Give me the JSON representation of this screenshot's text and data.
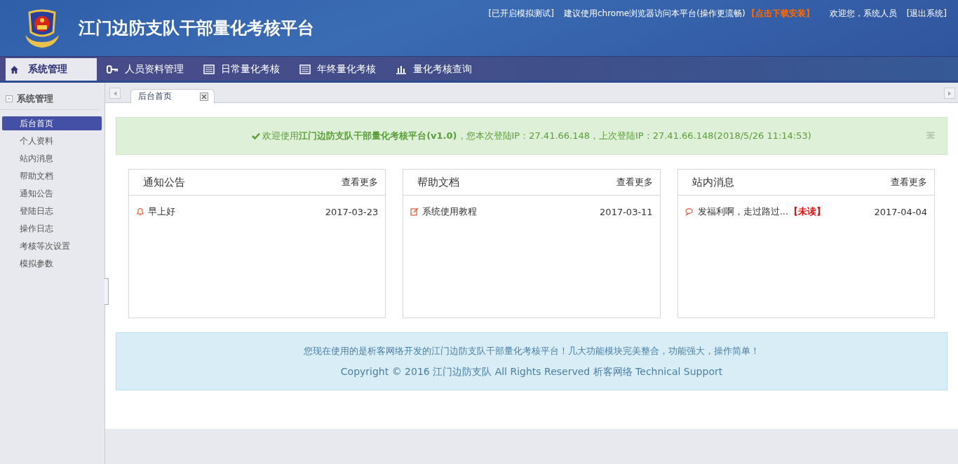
{
  "header": {
    "title": "江门边防支队干部量化考核平台",
    "top_links": [
      {
        "text": "[已开启模拟测试]",
        "kind": "plain"
      },
      {
        "text": "建议使用chrome浏览器访问本平台(操作更流畅)",
        "kind": "plain"
      },
      {
        "text": "【点击下载安装】",
        "kind": "highlight"
      },
      {
        "text": "欢迎您，系统人员",
        "kind": "plain"
      },
      {
        "text": "[退出系统]",
        "kind": "link"
      }
    ]
  },
  "nav": [
    {
      "label": "系统管理",
      "kind": "home",
      "selected": true
    },
    {
      "label": "人员资料管理",
      "kind": "key",
      "selected": false
    },
    {
      "label": "日常量化考核",
      "kind": "list",
      "selected": false
    },
    {
      "label": "年终量化考核",
      "kind": "list",
      "selected": false
    },
    {
      "label": "量化考核查询",
      "kind": "chart",
      "selected": false
    }
  ],
  "sidebar": {
    "title": "系统管理",
    "items": [
      {
        "label": "后台首页",
        "selected": true
      },
      {
        "label": "个人资料",
        "selected": false
      },
      {
        "label": "站内消息",
        "selected": false
      },
      {
        "label": "帮助文档",
        "selected": false
      },
      {
        "label": "通知公告",
        "selected": false
      },
      {
        "label": "登陆日志",
        "selected": false
      },
      {
        "label": "操作日志",
        "selected": false
      },
      {
        "label": "考核等次设置",
        "selected": false
      },
      {
        "label": "模拟参数",
        "selected": false
      }
    ]
  },
  "tabs": [
    {
      "label": "后台首页",
      "selected": true
    }
  ],
  "welcome": "欢迎使用**江门边防支队干部量化考核平台(v1.0)**，您本次登陆IP：27.41.66.148，上次登陆IP：27.41.66.148(2018/5/26 11:14:53)",
  "panels": [
    {
      "title": "通知公告",
      "more": "查看更多",
      "items": [
        {
          "kind": "notice",
          "text": "早上好",
          "date": "2017-03-23"
        }
      ]
    },
    {
      "title": "帮助文档",
      "more": "查看更多",
      "items": [
        {
          "kind": "doc",
          "text": "系统使用教程",
          "date": "2017-03-11"
        }
      ]
    },
    {
      "title": "站内消息",
      "more": "查看更多",
      "items": [
        {
          "kind": "message",
          "text": "发福利啊，走过路过...",
          "badge": "【未读】",
          "date": "2017-04-04"
        }
      ]
    }
  ],
  "footer": {
    "line1": "您现在使用的是析客网络开发的江门边防支队干部量化考核平台！几大功能模块完美整合，功能强大，操作简单！",
    "line2": "Copyright © 2016 江门边防支队 All Rights Reserved 析客网络 Technical Support"
  }
}
